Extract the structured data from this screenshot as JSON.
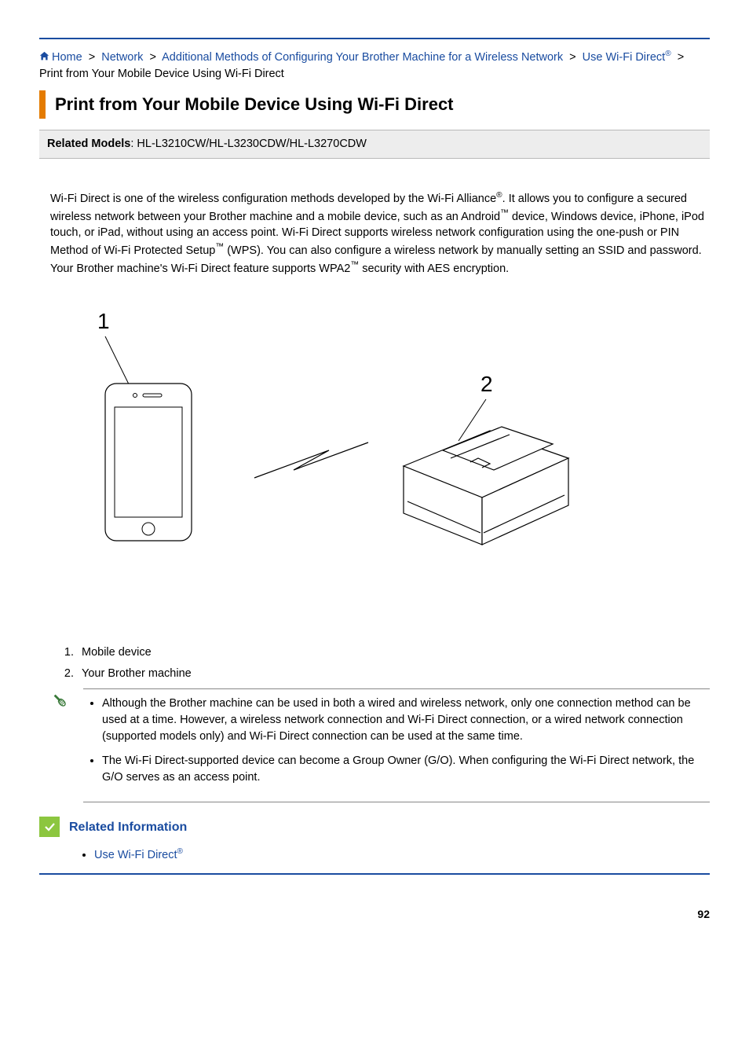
{
  "breadcrumb": {
    "home": "Home",
    "items": [
      {
        "label": "Network"
      },
      {
        "label": "Additional Methods of Configuring Your Brother Machine for a Wireless Network"
      },
      {
        "label_prefix": "Use Wi-Fi Direct",
        "reg": "®"
      }
    ],
    "current": "Print from Your Mobile Device Using Wi-Fi Direct",
    "sep": ">"
  },
  "title": "Print from Your Mobile Device Using Wi-Fi Direct",
  "models": {
    "label": "Related Models",
    "value": ": HL-L3210CW/HL-L3230CDW/HL-L3270CDW"
  },
  "intro": {
    "p1a": "Wi-Fi Direct is one of the wireless configuration methods developed by the Wi-Fi Alliance",
    "p1a_reg": "®",
    "p1b": ". It allows you to configure a secured wireless network between your Brother machine and a mobile device, such as an Android",
    "p1b_tm": "™",
    "p1c": " device, Windows device, iPhone, iPod touch, or iPad, without using an access point. Wi-Fi Direct supports wireless network configuration using the one-push or PIN Method of Wi-Fi Protected Setup",
    "p1c_tm": "™",
    "p1d": " (WPS). You can also configure a wireless network by manually setting an SSID and password. Your Brother machine's Wi-Fi Direct feature supports WPA2",
    "p1d_tm": "™",
    "p1e": " security with AES encryption."
  },
  "diagram": {
    "label1": "1",
    "label2": "2"
  },
  "legend": {
    "item1": "Mobile device",
    "item2": "Your Brother machine"
  },
  "notes": {
    "n1": "Although the Brother machine can be used in both a wired and wireless network, only one connection method can be used at a time. However, a wireless network connection and Wi-Fi Direct connection, or a wired network connection (supported models only) and Wi-Fi Direct connection can be used at the same time.",
    "n2": "The Wi-Fi Direct-supported device can become a Group Owner (G/O). When configuring the Wi-Fi Direct network, the G/O serves as an access point."
  },
  "related": {
    "heading": "Related Information",
    "link_text": "Use Wi-Fi Direct",
    "link_reg": "®"
  },
  "page_number": "92"
}
